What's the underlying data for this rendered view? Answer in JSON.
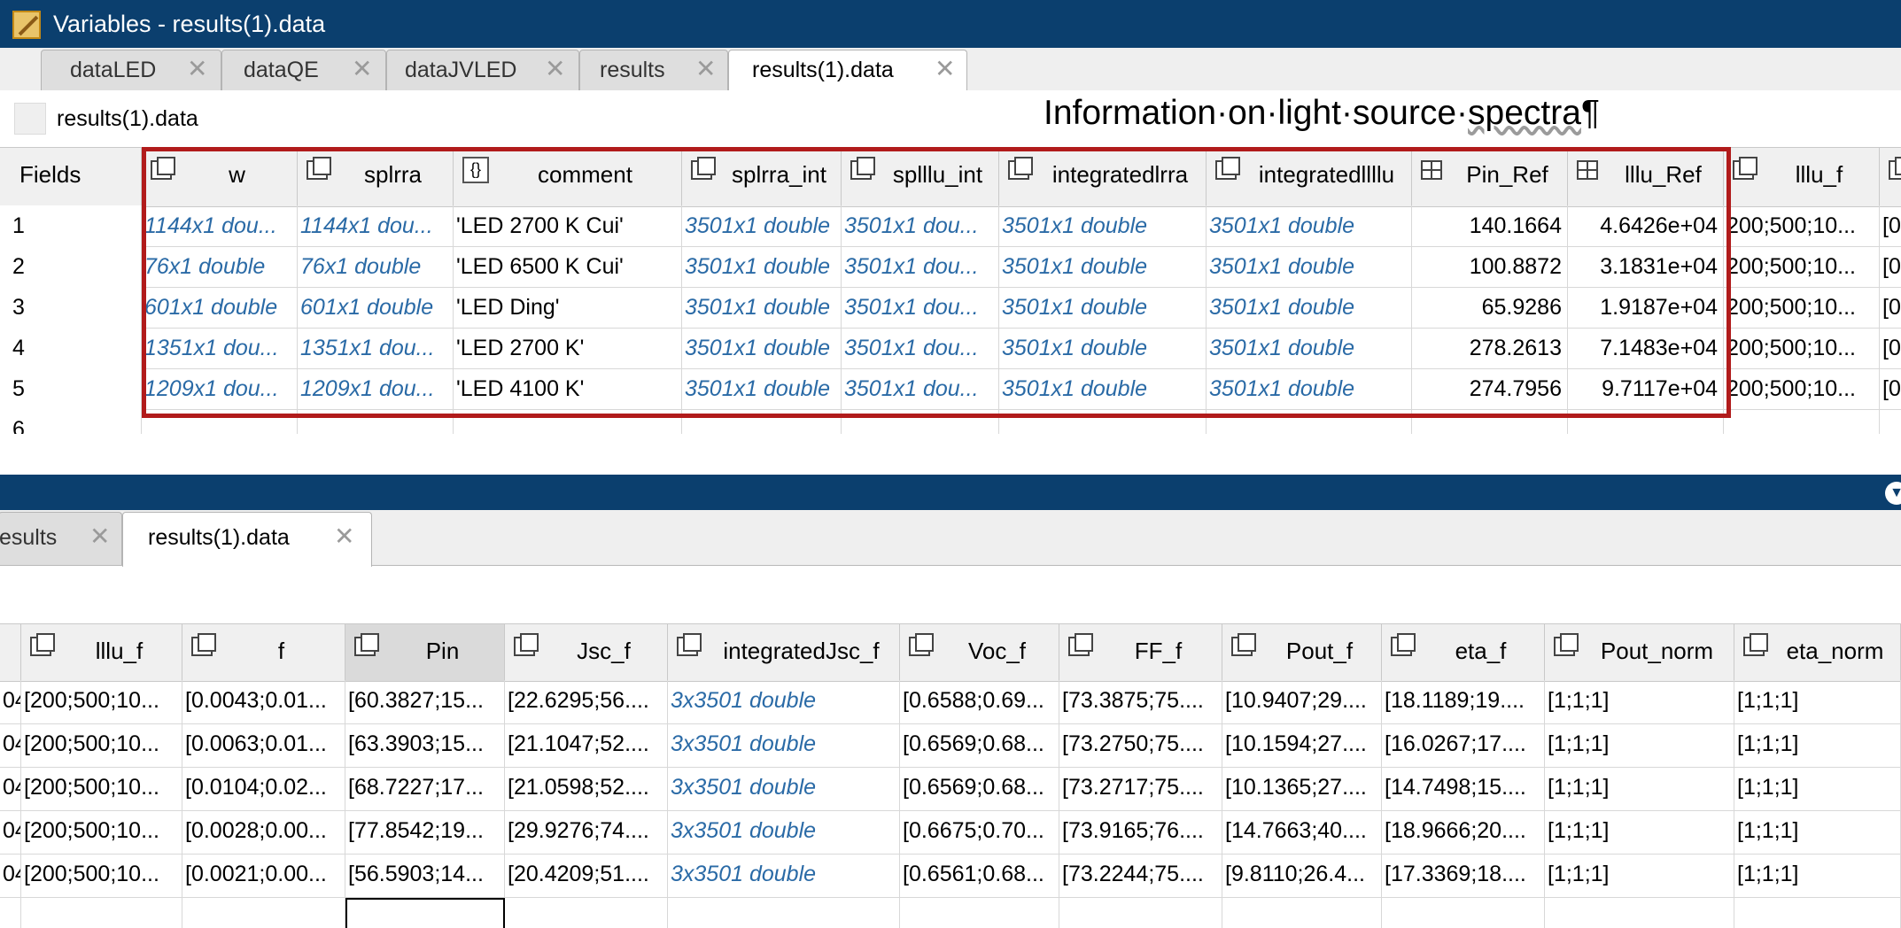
{
  "window": {
    "title": "Variables - results(1).data"
  },
  "top_tabs": [
    {
      "label": "dataLED"
    },
    {
      "label": "dataQE"
    },
    {
      "label": "dataJVLED"
    },
    {
      "label": "results"
    },
    {
      "label": "results(1).data"
    }
  ],
  "path": "results(1).data",
  "annotation": {
    "before": "Information·on·light·source·",
    "squiggled": "spectra",
    "after": "¶"
  },
  "top_grid": {
    "corner": "Fields",
    "headers": [
      "w",
      "splrra",
      "comment",
      "splrra_int",
      "splllu_int",
      "integratedlrra",
      "integratedllllu",
      "Pin_Ref",
      "lllu_Ref",
      "lllu_f",
      ""
    ],
    "header_icons": [
      "array-icon",
      "array-icon",
      "struct-icon",
      "array-icon",
      "array-icon",
      "array-icon",
      "array-icon",
      "cell-icon",
      "cell-icon",
      "array-icon",
      "array-icon"
    ],
    "rows": [
      {
        "n": "1",
        "cells": [
          "1144x1 dou...",
          "1144x1 dou...",
          "'LED 2700 K Cui'",
          "3501x1 double",
          "3501x1 dou...",
          "3501x1 double",
          "3501x1 double",
          "140.1664",
          "4.6426e+04",
          "200;500;10...",
          "[0"
        ]
      },
      {
        "n": "2",
        "cells": [
          "76x1 double",
          "76x1 double",
          "'LED 6500 K Cui'",
          "3501x1 double",
          "3501x1 dou...",
          "3501x1 double",
          "3501x1 double",
          "100.8872",
          "3.1831e+04",
          "200;500;10...",
          "[0"
        ]
      },
      {
        "n": "3",
        "cells": [
          "601x1 double",
          "601x1 double",
          "'LED Ding'",
          "3501x1 double",
          "3501x1 dou...",
          "3501x1 double",
          "3501x1 double",
          "65.9286",
          "1.9187e+04",
          "200;500;10...",
          "[0"
        ]
      },
      {
        "n": "4",
        "cells": [
          "1351x1 dou...",
          "1351x1 dou...",
          "'LED 2700 K'",
          "3501x1 double",
          "3501x1 dou...",
          "3501x1 double",
          "3501x1 double",
          "278.2613",
          "7.1483e+04",
          "200;500;10...",
          "[0"
        ]
      },
      {
        "n": "5",
        "cells": [
          "1209x1 dou...",
          "1209x1 dou...",
          "'LED 4100 K'",
          "3501x1 double",
          "3501x1 dou...",
          "3501x1 double",
          "3501x1 double",
          "274.7956",
          "9.7117e+04",
          "200;500;10...",
          "[0"
        ]
      },
      {
        "n": "6",
        "cells": [
          "",
          "",
          "",
          "",
          "",
          "",
          "",
          "",
          "",
          "",
          ""
        ]
      }
    ]
  },
  "bottom_tabs": [
    {
      "label": "esults"
    },
    {
      "label": "results(1).data"
    }
  ],
  "bottom_grid": {
    "headers": [
      "",
      "lllu_f",
      "f",
      "Pin",
      "Jsc_f",
      "integratedJsc_f",
      "Voc_f",
      "FF_f",
      "Pout_f",
      "eta_f",
      "Pout_norm",
      "eta_norm"
    ],
    "rows": [
      {
        "cells": [
          "04",
          "[200;500;10...",
          "[0.0043;0.01...",
          "[60.3827;15...",
          "[22.6295;56....",
          "3x3501 double",
          "[0.6588;0.69...",
          "[73.3875;75....",
          "[10.9407;29....",
          "[18.1189;19....",
          "[1;1;1]",
          "[1;1;1]"
        ]
      },
      {
        "cells": [
          "04",
          "[200;500;10...",
          "[0.0063;0.01...",
          "[63.3903;15...",
          "[21.1047;52....",
          "3x3501 double",
          "[0.6569;0.68...",
          "[73.2750;75....",
          "[10.1594;27....",
          "[16.0267;17....",
          "[1;1;1]",
          "[1;1;1]"
        ]
      },
      {
        "cells": [
          "04",
          "[200;500;10...",
          "[0.0104;0.02...",
          "[68.7227;17...",
          "[21.0598;52....",
          "3x3501 double",
          "[0.6569;0.68...",
          "[73.2717;75....",
          "[10.1365;27....",
          "[14.7498;15....",
          "[1;1;1]",
          "[1;1;1]"
        ]
      },
      {
        "cells": [
          "04",
          "[200;500;10...",
          "[0.0028;0.00...",
          "[77.8542;19...",
          "[29.9276;74....",
          "3x3501 double",
          "[0.6675;0.70...",
          "[73.9165;76....",
          "[14.7663;40....",
          "[18.9666;20....",
          "[1;1;1]",
          "[1;1;1]"
        ]
      },
      {
        "cells": [
          "04",
          "[200;500;10...",
          "[0.0021;0.00...",
          "[56.5903;14...",
          "[20.4209;51....",
          "3x3501 double",
          "[0.6561;0.68...",
          "[73.2244;75....",
          "[9.8110;26.4...",
          "[17.3369;18....",
          "[1;1;1]",
          "[1;1;1]"
        ]
      }
    ]
  },
  "colors": {
    "titlebar": "#0b3f6e",
    "highlight_box": "#b11b1b",
    "summary_text": "#2a6aa6"
  }
}
